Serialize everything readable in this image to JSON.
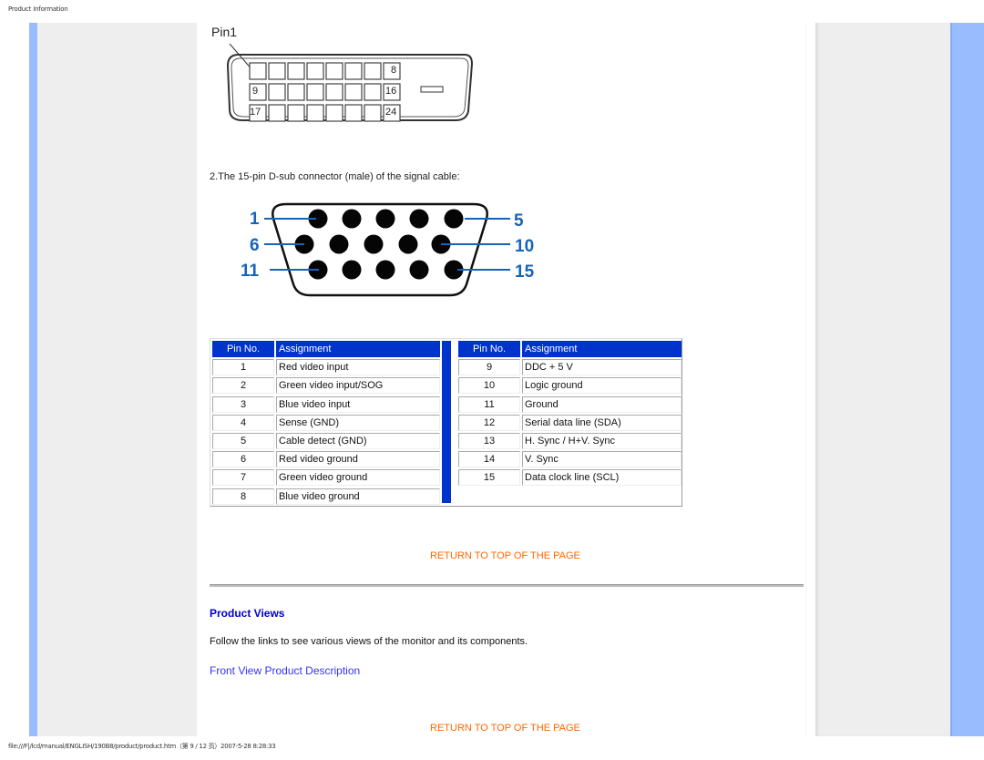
{
  "header": {
    "title": "Product Information"
  },
  "dvi": {
    "pin1_label": "Pin1",
    "labels": [
      "8",
      "9",
      "16",
      "17",
      "24"
    ]
  },
  "dsub": {
    "caption": "2.The 15-pin D-sub connector (male) of the signal cable:",
    "labels": [
      "1",
      "5",
      "6",
      "10",
      "11",
      "15"
    ]
  },
  "pin_table": {
    "headers": {
      "pin": "Pin No.",
      "assignment": "Assignment"
    },
    "left_rows": [
      {
        "pin": "1",
        "assignment": "Red video input"
      },
      {
        "pin": "2",
        "assignment": "Green video input/SOG"
      },
      {
        "pin": "3",
        "assignment": "Blue video input"
      },
      {
        "pin": "4",
        "assignment": "Sense (GND)"
      },
      {
        "pin": "5",
        "assignment": "Cable detect (GND)"
      },
      {
        "pin": "6",
        "assignment": "Red video ground"
      },
      {
        "pin": "7",
        "assignment": "Green video ground"
      },
      {
        "pin": "8",
        "assignment": "Blue video ground"
      }
    ],
    "right_rows": [
      {
        "pin": "9",
        "assignment": "DDC + 5 V"
      },
      {
        "pin": "10",
        "assignment": "Logic ground"
      },
      {
        "pin": "11",
        "assignment": "Ground"
      },
      {
        "pin": "12",
        "assignment": "Serial data line (SDA)"
      },
      {
        "pin": "13",
        "assignment": "H. Sync / H+V. Sync"
      },
      {
        "pin": "14",
        "assignment": "V. Sync"
      },
      {
        "pin": "15",
        "assignment": "Data clock line (SCL)"
      }
    ]
  },
  "links": {
    "return_top": "RETURN TO TOP OF THE PAGE",
    "front_view": "Front View Product Description"
  },
  "product_views": {
    "title": "Product Views",
    "description": "Follow the links to see various views of the monitor and its components."
  },
  "footer": {
    "path": "file:///F|/lcd/manual/ENGLISH/190B8/product/product.htm（第 9 / 12 页）2007-5-28 8:28:33"
  },
  "colors": {
    "accent_blue": "#0033cc",
    "link_orange": "#ff6600",
    "sidebar_blue": "#99bbff",
    "sidebar_grey": "#eeeeee"
  }
}
